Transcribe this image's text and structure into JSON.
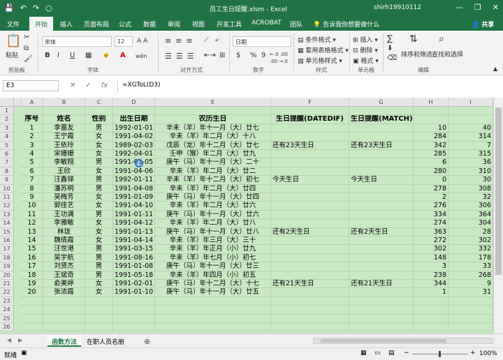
{
  "window": {
    "title": "员工生日提醒.xlsm - Excel",
    "user": "shirh19910112",
    "minimize": "—",
    "restore": "❐",
    "close": "✕"
  },
  "qat": {
    "save": "💾",
    "undo": "↶",
    "redo": "↷",
    "circle": "○"
  },
  "tabs": [
    {
      "label": "文件"
    },
    {
      "label": "开始"
    },
    {
      "label": "插入"
    },
    {
      "label": "页面布局"
    },
    {
      "label": "公式"
    },
    {
      "label": "数据"
    },
    {
      "label": "审阅"
    },
    {
      "label": "视图"
    },
    {
      "label": "开发工具"
    },
    {
      "label": "ACROBAT"
    },
    {
      "label": "团队"
    }
  ],
  "tellme": "告诉我你想要做什么",
  "share": "共享",
  "ribbon": {
    "paste": "粘贴",
    "clipboard": "剪贴板",
    "font_name": "宋体",
    "font_size": "12",
    "font_group": "字体",
    "bold": "B",
    "italic": "I",
    "underline": "U",
    "font_color": "A",
    "wen": "wén",
    "align_group": "对齐方式",
    "number_format": "日期",
    "number_group": "数字",
    "currency": "$",
    "percent": "%",
    "comma": "9",
    "dec_inc": "←.0 .00",
    "dec_dec": ".00 →.0",
    "cond_format": "条件格式",
    "table_format": "套用表格格式",
    "cell_style": "单元格样式",
    "style_group": "样式",
    "insert": "插入",
    "delete": "删除",
    "format": "格式",
    "cells_group": "单元格",
    "sort_filter": "排序和筛选",
    "find_select": "查找和选择",
    "edit_group": "编辑",
    "sum": "∑",
    "font_grow": "A A"
  },
  "formula_bar": {
    "name_box": "E3",
    "cancel": "✕",
    "enter": "✓",
    "fx": "fx",
    "formula": "=XGToL(D3)"
  },
  "columns": [
    "A",
    "B",
    "C",
    "D",
    "E",
    "F",
    "G",
    "H",
    "I"
  ],
  "header_row": [
    "序号",
    "姓名",
    "性别",
    "出生日期",
    "农历生日",
    "生日提醒(DATEDIF)",
    "生日提醒(MATCH)",
    "",
    ""
  ],
  "rows": [
    [
      "1",
      "李蔷友",
      "男",
      "1992-01-01",
      "辛未（羊）年十一月（大）廿七",
      "",
      "",
      "10",
      "40"
    ],
    [
      "2",
      "王宁霞",
      "女",
      "1991-04-02",
      "辛未（羊）年二月（大）十八",
      "",
      "",
      "284",
      "314"
    ],
    [
      "3",
      "王依玲",
      "女",
      "1989-02-03",
      "戊辰（龙）年十二月（大）廿七",
      "还有23天生日",
      "还有23天生日",
      "342",
      "7"
    ],
    [
      "4",
      "宋姗姗",
      "女",
      "1992-04-01",
      "壬申（猴）年二月（大）廿九",
      "",
      "",
      "285",
      "315"
    ],
    [
      "5",
      "李敏翔",
      "男",
      "1991-01-05",
      "庚午（马）年十一月（大）二十",
      "",
      "",
      "6",
      "36"
    ],
    [
      "6",
      "王欣",
      "女",
      "1991-04-06",
      "辛未（羊）年二月（大）廿二",
      "",
      "",
      "280",
      "310"
    ],
    [
      "7",
      "汪鑫铎",
      "男",
      "1992-01-11",
      "辛未（羊）年十二月（大）初七",
      "今天生日",
      "今天生日",
      "0",
      "30"
    ],
    [
      "8",
      "潘苏明",
      "男",
      "1991-04-08",
      "辛未（羊）年二月（大）廿四",
      "",
      "",
      "278",
      "308"
    ],
    [
      "9",
      "吴梅芳",
      "女",
      "1991-01-09",
      "庚午（马）年十一月（大）廿四",
      "",
      "",
      "2",
      "32"
    ],
    [
      "10",
      "郭佳艺",
      "女",
      "1991-04-10",
      "辛未（羊）年二月（大）廿六",
      "",
      "",
      "276",
      "306"
    ],
    [
      "11",
      "王功满",
      "男",
      "1991-01-11",
      "庚午（马）年十一月（大）廿六",
      "",
      "",
      "334",
      "364"
    ],
    [
      "12",
      "李雅敏",
      "女",
      "1991-04-12",
      "辛未（羊）年二月（大）廿八",
      "",
      "",
      "274",
      "304"
    ],
    [
      "13",
      "林珑",
      "女",
      "1991-01-13",
      "庚午（马）年十一月（大）廿八",
      "还有2天生日",
      "还有2天生日",
      "363",
      "28"
    ],
    [
      "14",
      "魏倩霞",
      "女",
      "1991-04-14",
      "辛未（羊）年三月（大）三十",
      "",
      "",
      "272",
      "302"
    ],
    [
      "15",
      "汪世港",
      "男",
      "1991-03-15",
      "辛未（羊）年正月（小）廿九",
      "",
      "",
      "302",
      "332"
    ],
    [
      "16",
      "吴宇航",
      "男",
      "1991-08-16",
      "辛未（羊）年七月（小）初七",
      "",
      "",
      "148",
      "178"
    ],
    [
      "17",
      "刘贤杰",
      "男",
      "1991-01-08",
      "庚午（马）年十一月（大）廿三",
      "",
      "",
      "3",
      "33"
    ],
    [
      "18",
      "王斌奇",
      "男",
      "1991-05-18",
      "辛未（羊）年四月（小）初五",
      "",
      "",
      "238",
      "268"
    ],
    [
      "19",
      "俞美婷",
      "女",
      "1991-02-01",
      "庚午（马）年十二月（大）十七",
      "还有21天生日",
      "还有21天生日",
      "344",
      "9"
    ],
    [
      "20",
      "张浓霞",
      "女",
      "1991-01-10",
      "庚午（马）年十一月（大）廿五",
      "",
      "",
      "1",
      "31"
    ]
  ],
  "row_numbers": [
    "1",
    "2",
    "3",
    "4",
    "5",
    "6",
    "7",
    "8",
    "9",
    "10",
    "11",
    "12",
    "13",
    "14",
    "15",
    "16",
    "17",
    "18",
    "19",
    "20",
    "21",
    "22",
    "23",
    "24",
    "25",
    "26"
  ],
  "sheet_tabs": [
    "函数方法",
    "在职人员名册"
  ],
  "add_sheet": "⊕",
  "status": {
    "ready": "就绪",
    "zoom": "100%",
    "minus": "−",
    "plus": "+"
  }
}
